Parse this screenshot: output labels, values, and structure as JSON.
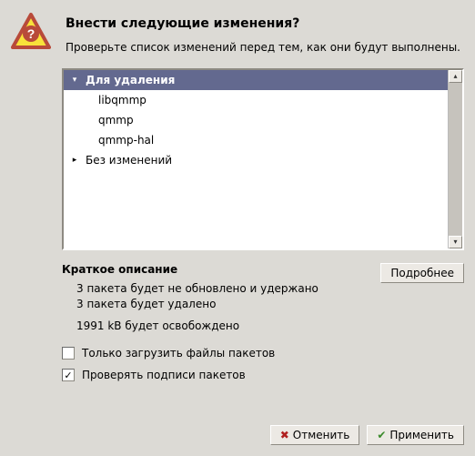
{
  "header": {
    "title": "Внести следующие изменения?",
    "subtitle": "Проверьте список изменений перед тем, как они будут выполнены."
  },
  "tree": {
    "group_remove": {
      "label": "Для удаления"
    },
    "items": [
      "libqmmp",
      "qmmp",
      "qmmp-hal"
    ],
    "group_nochange": {
      "label": "Без изменений"
    }
  },
  "summary": {
    "title": "Краткое описание",
    "line1": "3 пакета будет не обновлено и удержано",
    "line2": "3 пакета будет удалено",
    "line3": "1991 kB будет освобождено"
  },
  "buttons": {
    "details": "Подробнее",
    "cancel": "Отменить",
    "apply": "Применить"
  },
  "checkboxes": {
    "download_only": {
      "label": "Только загрузить файлы пакетов",
      "checked": false
    },
    "verify_sigs": {
      "label": "Проверять подписи пакетов",
      "checked": true
    }
  },
  "icons": {
    "warning": "warning-question-icon",
    "cancel": "cancel-icon",
    "apply": "apply-icon"
  }
}
